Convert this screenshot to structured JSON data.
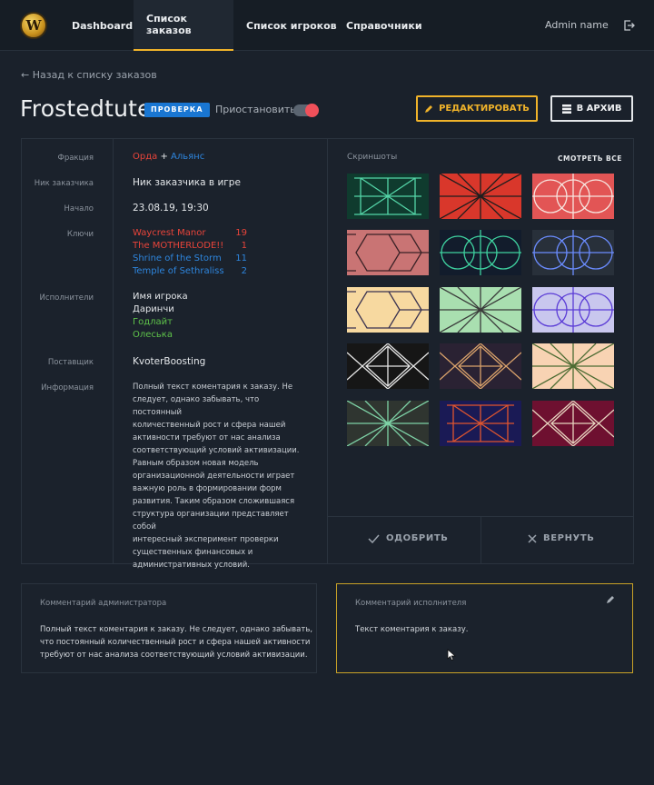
{
  "nav": {
    "logo": "W",
    "items": [
      {
        "label": "Dashboard"
      },
      {
        "label": "Список заказов"
      },
      {
        "label": "Список игроков"
      },
      {
        "label": "Справочники"
      }
    ],
    "admin_name": "Admin name",
    "logout_icon": "logout-icon"
  },
  "header": {
    "back_link": "← Назад к списку заказов",
    "order_title": "Frostedtute",
    "status_badge": "ПРОВЕРКА",
    "pause_label": "Приостановить",
    "pause_enabled": true,
    "edit_button": "РЕДАКТИРОВАТЬ",
    "archive_button": "В АРХИВ",
    "colors": {
      "accent": "#f0b32a",
      "badge": "#1976d2",
      "toggle": "#f0505a"
    }
  },
  "details": {
    "faction": {
      "label": "Фракция",
      "horde": "Орда",
      "plus": "+",
      "alliance": "Альянс"
    },
    "customer_nick": {
      "label": "Ник заказчика",
      "value": "Ник заказчика в игре"
    },
    "start": {
      "label": "Начало",
      "value": "23.08.19, 19:30"
    },
    "keys": {
      "label": "Ключи",
      "items": [
        {
          "name": "Waycrest Manor",
          "level": "19",
          "color": "#e8443a"
        },
        {
          "name": "The MOTHERLODE!!",
          "level": "1",
          "color": "#e8443a"
        },
        {
          "name": "Shrine of the Storm",
          "level": "11",
          "color": "#2e86de"
        },
        {
          "name": "Temple of Sethraliss",
          "level": "2",
          "color": "#2e86de"
        }
      ]
    },
    "performers": {
      "label": "Исполнители",
      "items": [
        {
          "name": "Имя игрока",
          "color": "#e4e7ea"
        },
        {
          "name": "Даринчи",
          "color": "#e4e7ea"
        },
        {
          "name": "Годлайт",
          "color": "#5ec24a"
        },
        {
          "name": "Олеська",
          "color": "#5ec24a"
        }
      ]
    },
    "supplier": {
      "label": "Поставщик",
      "value": "KvoterBoosting"
    },
    "info": {
      "label": "Информация",
      "lines": [
        "Полный текст коментария к заказу. Не",
        "следует, однако забывать, что постоянный",
        "количественный рост и сфера нашей",
        "активности требуют от нас анализа",
        "соответствующий условий активизации.",
        "Равным образом новая модель",
        "организационной деятельности играет",
        "важную роль в формировании форм",
        "развития. Таким образом сложившаяся",
        "структура организации представляет собой",
        "интересный эксперимент проверки",
        "существенных финансовых и",
        "административных условий."
      ]
    }
  },
  "screenshots": {
    "title": "Скриншоты",
    "view_all": "СМОТРЕТЬ ВСЕ",
    "thumbs": [
      {
        "bg": "#0f3b2e",
        "fg": "#54d6a8",
        "pattern": "grid"
      },
      {
        "bg": "#d9372b",
        "fg": "#1d1d1d",
        "pattern": "star"
      },
      {
        "bg": "#e25555",
        "fg": "#f7e6e0",
        "pattern": "circles"
      },
      {
        "bg": "#c97474",
        "fg": "#3a2226",
        "pattern": "hex"
      },
      {
        "bg": "#121c2c",
        "fg": "#3fd2a0",
        "pattern": "circles"
      },
      {
        "bg": "#28303a",
        "fg": "#6b8cff",
        "pattern": "circles"
      },
      {
        "bg": "#f7d9a0",
        "fg": "#3a3250",
        "pattern": "hex"
      },
      {
        "bg": "#a9dfb0",
        "fg": "#3a3a3a",
        "pattern": "star"
      },
      {
        "bg": "#c9c7ee",
        "fg": "#5a3bd6",
        "pattern": "circles"
      },
      {
        "bg": "#161616",
        "fg": "#e6e6e6",
        "pattern": "diamond"
      },
      {
        "bg": "#2a2233",
        "fg": "#d9a26b",
        "pattern": "diamond"
      },
      {
        "bg": "#f8d3b3",
        "fg": "#4b6b32",
        "pattern": "star"
      },
      {
        "bg": "#2f3530",
        "fg": "#7ed2a6",
        "pattern": "star"
      },
      {
        "bg": "#1a1a55",
        "fg": "#e0552f",
        "pattern": "grid"
      },
      {
        "bg": "#6e1030",
        "fg": "#e8d5c0",
        "pattern": "diamond"
      }
    ]
  },
  "actions": {
    "approve": "ОДОБРИТЬ",
    "return": "ВЕРНУТЬ"
  },
  "comments": {
    "admin": {
      "title": "Комментарий администратора",
      "lines": [
        "Полный текст коментария к заказу. Не следует, однако забывать,",
        "что постоянный количественный рост и сфера нашей активности",
        "требуют от нас анализа соответствующий условий активизации."
      ]
    },
    "performer": {
      "title": "Комментарий исполнителя",
      "text": "Текст коментария к заказу."
    }
  }
}
